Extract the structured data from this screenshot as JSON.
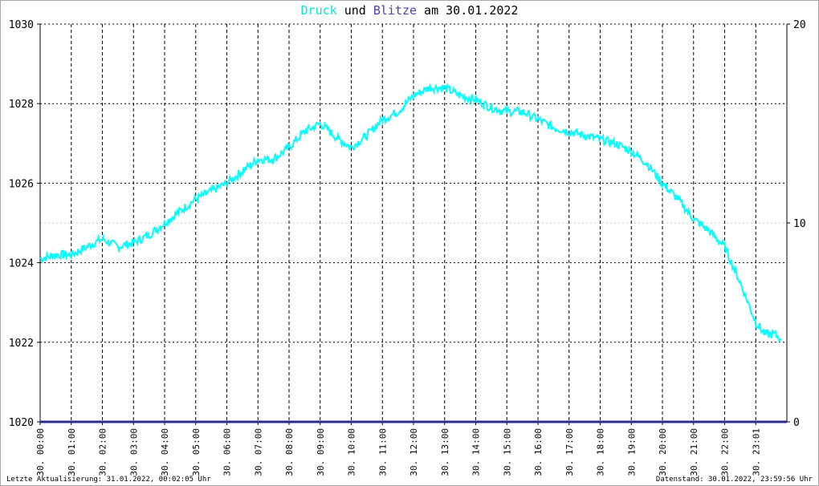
{
  "title": {
    "part1": "Druck",
    "part2": " und ",
    "part3": "Blitze",
    "part4": " am 30.01.2022"
  },
  "colors": {
    "pressure": "#00ffff",
    "lightning": "#2b2b8a",
    "grid": "#000000",
    "background": "#ffffff"
  },
  "footer": {
    "left": "Letzte Aktualisierung: 31.01.2022, 00:02:05 Uhr",
    "right": "Datenstand: 30.01.2022, 23:59:56 Uhr"
  },
  "chart_data": {
    "type": "line",
    "ylim_left": [
      1020,
      1030
    ],
    "yticks_left": [
      "1020",
      "1022",
      "1024",
      "1026",
      "1028",
      "1030"
    ],
    "ylim_right": [
      0,
      20
    ],
    "yticks_right": [
      "0",
      "10",
      "20"
    ],
    "xlim": [
      0,
      24
    ],
    "x_ticks": [
      {
        "x": 0,
        "label": "30. 00:00"
      },
      {
        "x": 1,
        "label": "30. 01:00"
      },
      {
        "x": 2,
        "label": "30. 02:00"
      },
      {
        "x": 3,
        "label": "30. 03:00"
      },
      {
        "x": 4,
        "label": "30. 04:00"
      },
      {
        "x": 5,
        "label": "30. 05:00"
      },
      {
        "x": 6,
        "label": "30. 06:00"
      },
      {
        "x": 7,
        "label": "30. 07:00"
      },
      {
        "x": 8,
        "label": "30. 08:00"
      },
      {
        "x": 9,
        "label": "30. 09:00"
      },
      {
        "x": 10,
        "label": "30. 10:00"
      },
      {
        "x": 11,
        "label": "30. 11:00"
      },
      {
        "x": 12,
        "label": "30. 12:00"
      },
      {
        "x": 13,
        "label": "30. 13:00"
      },
      {
        "x": 14,
        "label": "30. 14:00"
      },
      {
        "x": 15,
        "label": "30. 15:00"
      },
      {
        "x": 16,
        "label": "30. 16:00"
      },
      {
        "x": 17,
        "label": "30. 17:00"
      },
      {
        "x": 18,
        "label": "30. 18:00"
      },
      {
        "x": 19,
        "label": "30. 19:00"
      },
      {
        "x": 20,
        "label": "30. 20:00"
      },
      {
        "x": 21,
        "label": "30. 21:00"
      },
      {
        "x": 22,
        "label": "30. 22:00"
      },
      {
        "x": 23,
        "label": "30. 23:01"
      }
    ],
    "grid": true,
    "series": [
      {
        "name": "Druck",
        "color": "#00ffff",
        "axis": "left",
        "x": [
          0,
          0.5,
          1,
          1.5,
          2,
          2.5,
          3,
          3.5,
          4,
          4.5,
          5,
          5.5,
          6,
          6.5,
          7,
          7.5,
          8,
          8.5,
          9,
          9.3,
          9.6,
          10,
          10.5,
          11,
          11.5,
          12,
          12.5,
          13,
          13.5,
          14,
          14.5,
          15,
          15.5,
          16,
          16.5,
          17,
          17.5,
          18,
          18.5,
          19,
          19.5,
          20,
          20.5,
          21,
          21.5,
          22,
          22.5,
          23,
          23.3,
          23.6,
          23.8
        ],
        "y": [
          1024.1,
          1024.2,
          1024.2,
          1024.4,
          1024.6,
          1024.4,
          1024.5,
          1024.7,
          1025.0,
          1025.3,
          1025.6,
          1025.8,
          1026.0,
          1026.3,
          1026.6,
          1026.6,
          1026.9,
          1027.3,
          1027.5,
          1027.3,
          1027.1,
          1026.9,
          1027.2,
          1027.6,
          1027.8,
          1028.2,
          1028.4,
          1028.4,
          1028.2,
          1028.1,
          1027.9,
          1027.8,
          1027.8,
          1027.6,
          1027.4,
          1027.3,
          1027.2,
          1027.1,
          1027.0,
          1026.8,
          1026.5,
          1026.0,
          1025.6,
          1025.1,
          1024.8,
          1024.4,
          1023.5,
          1022.5,
          1022.2,
          1022.2,
          1022.1
        ]
      },
      {
        "name": "Blitze",
        "color": "#2b2b8a",
        "axis": "right",
        "x": [
          0,
          24
        ],
        "y": [
          0,
          0
        ]
      }
    ]
  }
}
